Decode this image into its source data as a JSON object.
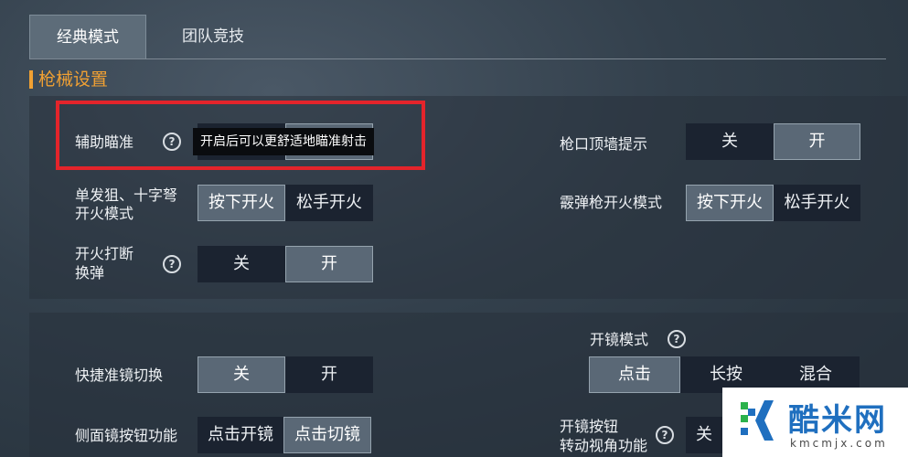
{
  "tabs": [
    {
      "label": "经典模式",
      "active": true
    },
    {
      "label": "团队竞技",
      "active": false
    }
  ],
  "section_title": "枪械设置",
  "settings": {
    "aim_assist": {
      "label": "辅助瞄准",
      "tooltip": "开启后可以更舒适地瞄准射击"
    },
    "muzzle_wall": {
      "label": "枪口顶墙提示",
      "off": "关",
      "on": "开",
      "selected": "开"
    },
    "sniper_fire": {
      "label_line1": "单发狙、十字弩",
      "label_line2": "开火模式",
      "opt1": "按下开火",
      "opt2": "松手开火",
      "selected": "按下开火"
    },
    "shotgun_fire": {
      "label": "霰弹枪开火模式",
      "opt1": "按下开火",
      "opt2": "松手开火",
      "selected": "按下开火"
    },
    "fire_interrupt": {
      "label_line1": "开火打断",
      "label_line2": "换弹",
      "off": "关",
      "on": "开",
      "selected": "开"
    },
    "quick_scope": {
      "label": "快捷准镜切换",
      "off": "关",
      "on": "开",
      "selected": "关"
    },
    "scope_mode": {
      "label": "开镜模式",
      "opt1": "点击",
      "opt2": "长按",
      "opt3": "混合",
      "selected": "点击"
    },
    "side_scope": {
      "label": "侧面镜按钮功能",
      "opt1": "点击开镜",
      "opt2": "点击切镜",
      "selected": "点击切镜"
    },
    "scope_button_view": {
      "label_line1": "开镜按钮",
      "label_line2": "转动视角功能",
      "partial": "关"
    }
  },
  "watermark": {
    "name": "酷米网",
    "url": "kmcmjx.com"
  },
  "colors": {
    "accent": "#f0a033",
    "highlight_box": "#e4242b",
    "selected_bg": "#5a6876",
    "unselected_bg": "#1b2330"
  }
}
